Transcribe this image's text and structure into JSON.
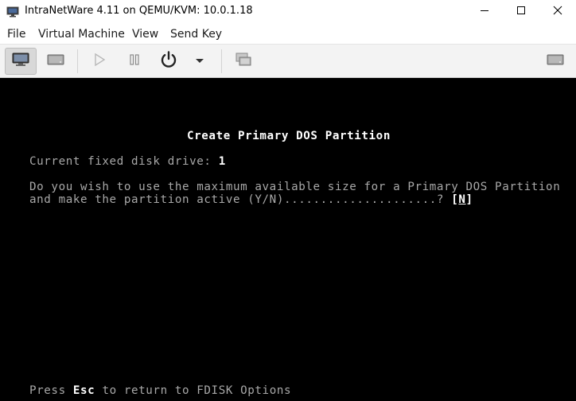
{
  "window": {
    "title": "IntraNetWare 4.11 on QEMU/KVM: 10.0.1.18",
    "app_icon": "monitor-icon",
    "controls": [
      "minimize-icon",
      "maximize-icon",
      "close-icon"
    ]
  },
  "menu": {
    "file": "File",
    "virtual_machine": "Virtual Machine",
    "view": "View",
    "send_key": "Send Key"
  },
  "toolbar": {
    "icons": [
      "console-icon",
      "details-icon",
      "run-icon",
      "pause-icon",
      "power-icon",
      "power-menu-chevron-icon",
      "snapshots-icon",
      "fullscreen-icon"
    ]
  },
  "console": {
    "heading": "Create Primary DOS Partition",
    "drive_label": "Current fixed disk drive: ",
    "drive_value": "1",
    "question_line1": "Do you wish to use the maximum available size for a Primary DOS Partition",
    "question_line2": "and make the partition active (Y/N).....................? ",
    "bracket_open": "[",
    "answer": "N",
    "bracket_close": "]",
    "footer_pre": "Press ",
    "footer_key": "Esc",
    "footer_post": " to return to FDISK Options"
  },
  "colors": {
    "console_bg": "#000000",
    "console_text": "#a8a8a8",
    "console_bright": "#ffffff"
  }
}
